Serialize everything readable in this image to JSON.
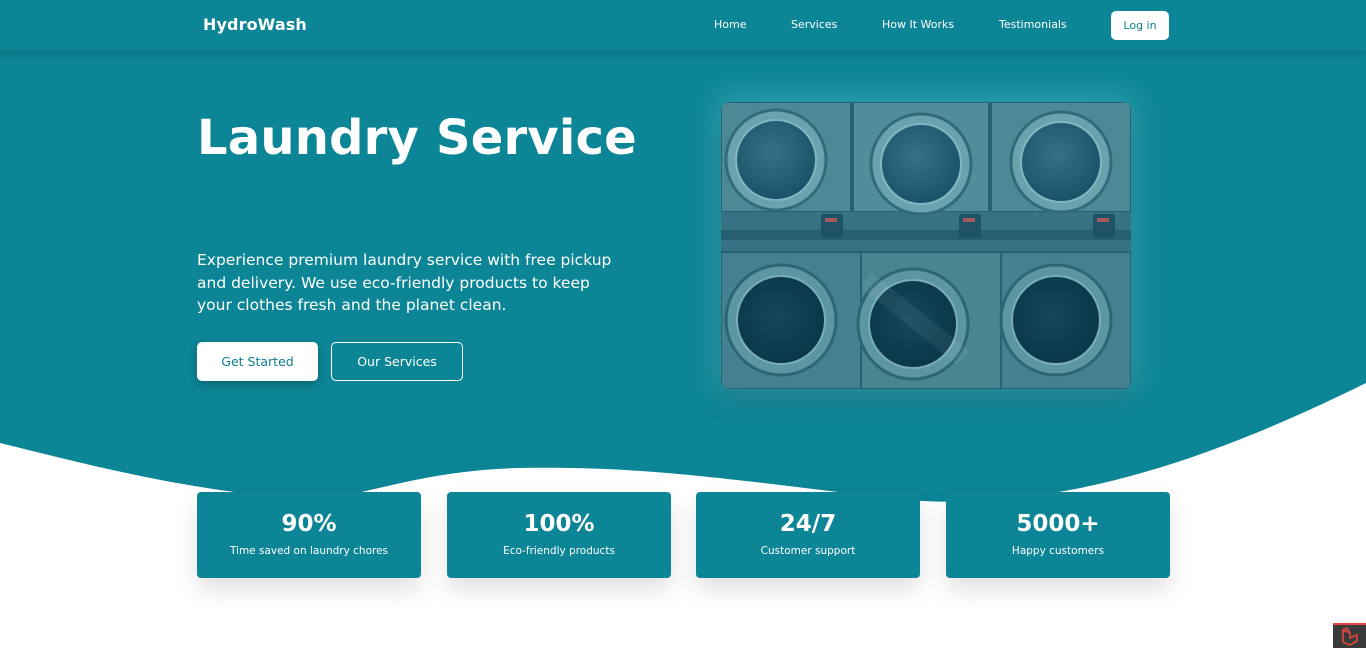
{
  "nav": {
    "brand": "HydroWash",
    "links": [
      "Home",
      "Services",
      "How It Works",
      "Testimonials"
    ],
    "login_label": "Log in"
  },
  "hero": {
    "title": "Laundry Service",
    "description": "Experience premium laundry service with free pickup and delivery. We use eco-friendly products to keep your clothes fresh and the planet clean.",
    "primary_button": "Get Started",
    "secondary_button": "Our Services",
    "image_alt": "laundromat-washing-machines"
  },
  "stats": [
    {
      "value": "90%",
      "label": "Time saved on laundry chores"
    },
    {
      "value": "100%",
      "label": "Eco-friendly products"
    },
    {
      "value": "24/7",
      "label": "Customer support"
    },
    {
      "value": "5000+",
      "label": "Happy customers"
    }
  ],
  "colors": {
    "primary": "#0c8596",
    "background": "#ffffff",
    "text_on_primary": "#ffffff"
  },
  "icons": {
    "corner_badge": "laravel-logo-icon"
  }
}
